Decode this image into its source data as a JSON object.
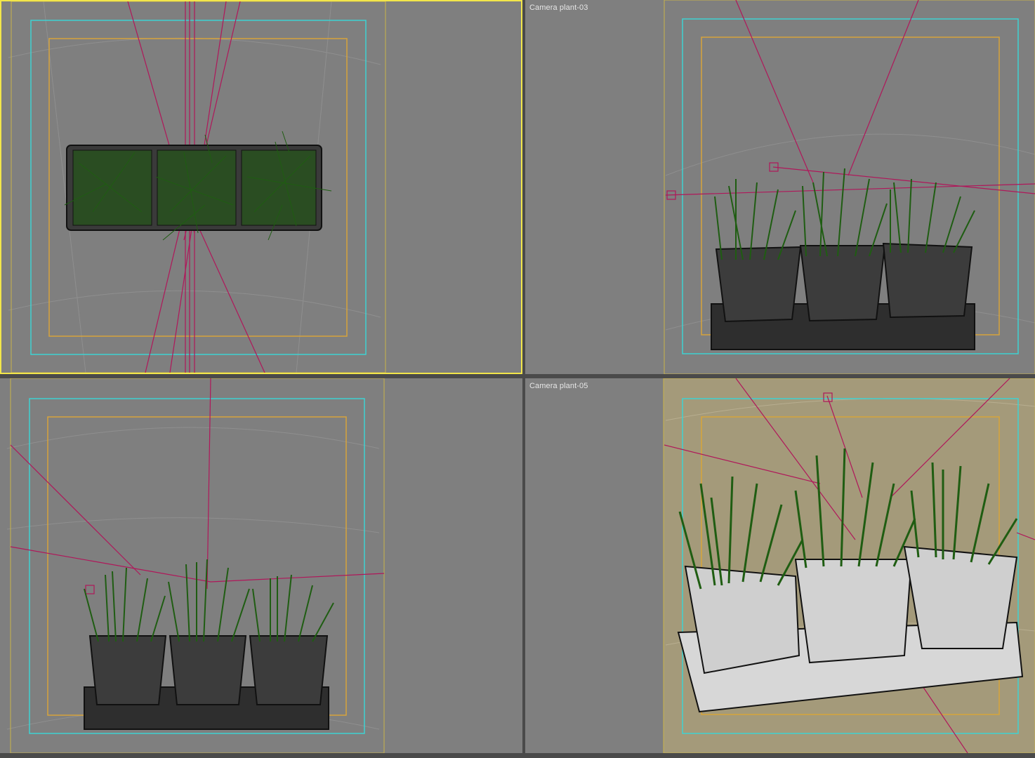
{
  "viewports": [
    {
      "id": "top",
      "label": "",
      "active": true
    },
    {
      "id": "camera-03",
      "label": "Camera plant-03",
      "active": false
    },
    {
      "id": "front",
      "label": "",
      "active": false
    },
    {
      "id": "camera-05",
      "label": "Camera plant-05",
      "active": false
    }
  ],
  "colors": {
    "viewport_bg": "#7f7f7f",
    "active_border": "#f2e64a",
    "safe_frame_outer": "#c8b34a",
    "safe_frame_action": "#3fd2d2",
    "safe_frame_title": "#d7a43b",
    "camera_line": "#b0175a",
    "plant": "#1f5d12",
    "wire": "#111111",
    "rendered_bg": "#a49a7a"
  }
}
